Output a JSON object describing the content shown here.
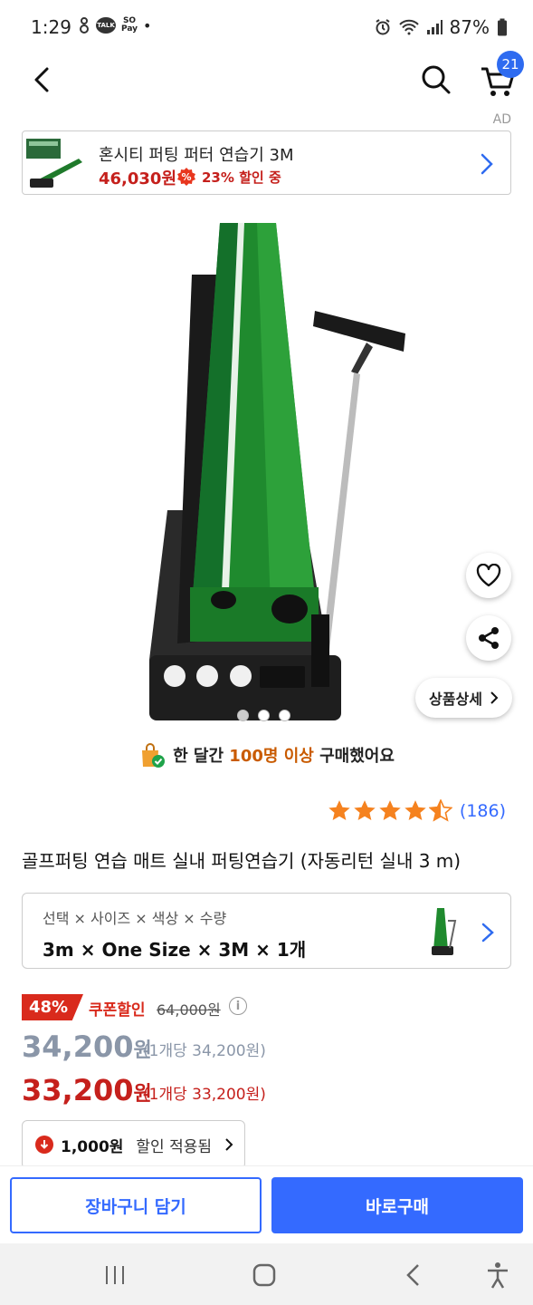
{
  "status": {
    "time": "1:29",
    "battery": "87%",
    "talk": "TALK",
    "pay_top": "SO",
    "pay_bottom": "Pay",
    "dot": "•"
  },
  "header": {
    "cart_count": "21"
  },
  "ad": {
    "label": "AD",
    "title": "혼시티 퍼팅 퍼터 연습기 3M",
    "price": "46,030원",
    "discount": "23% 할인 중"
  },
  "detail_button": "상품상세",
  "bought": {
    "prefix": "한 달간 ",
    "highlight": "100명 이상",
    "suffix": " 구매했어요"
  },
  "rating": {
    "stars": 4.5,
    "count": "(186)"
  },
  "product": {
    "title": "골프퍼팅 연습 매트 실내 퍼팅연습기 (자동리턴 실내 3 m)"
  },
  "option": {
    "label": "선택 × 사이즈 × 색상 × 수량",
    "value": "3m × One Size × 3M × 1개"
  },
  "pricing": {
    "discount_rate": "48%",
    "coupon_label": "쿠폰할인",
    "original_price": "64,000원",
    "price1_num": "34,200",
    "price1_unit": "원",
    "price1_per": "(1개당 34,200원)",
    "price2_num": "33,200",
    "price2_unit": "원",
    "price2_per": "(1개당 33,200원)"
  },
  "applied": {
    "amount": "1,000원",
    "text": "할인 적용됨"
  },
  "buttons": {
    "cart": "장바구니 담기",
    "buy": "바로구매"
  },
  "colors": {
    "accent": "#346aff",
    "sale_red": "#c5201c",
    "cart_badge": "#2e6bf0"
  }
}
